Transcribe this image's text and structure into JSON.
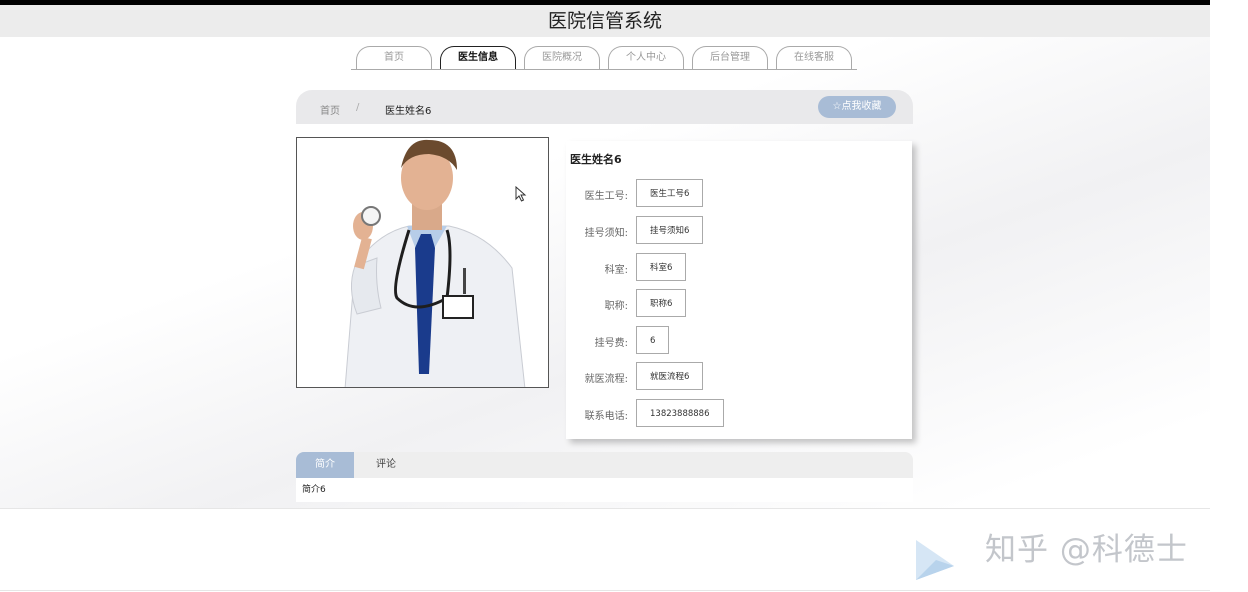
{
  "app": {
    "title": "医院信管系统"
  },
  "nav": {
    "tabs": [
      {
        "label": "首页",
        "active": false
      },
      {
        "label": "医生信息",
        "active": true
      },
      {
        "label": "医院概况",
        "active": false
      },
      {
        "label": "个人中心",
        "active": false
      },
      {
        "label": "后台管理",
        "active": false
      },
      {
        "label": "在线客服",
        "active": false
      }
    ]
  },
  "breadcrumb": {
    "home": "首页",
    "separator": "/",
    "current": "医生姓名6"
  },
  "favorite": {
    "label": "☆点我收藏"
  },
  "doctor": {
    "name": "医生姓名6",
    "fields": [
      {
        "label": "医生工号:",
        "value": "医生工号6"
      },
      {
        "label": "挂号须知:",
        "value": "挂号须知6"
      },
      {
        "label": "科室:",
        "value": "科室6"
      },
      {
        "label": "职称:",
        "value": "职称6"
      },
      {
        "label": "挂号费:",
        "value": "6"
      },
      {
        "label": "就医流程:",
        "value": "就医流程6"
      },
      {
        "label": "联系电话:",
        "value": "13823888886"
      }
    ]
  },
  "detail_tabs": {
    "intro": "简介",
    "review": "评论",
    "intro_content": "简介6"
  },
  "watermark": {
    "text": "知乎 @科德士"
  },
  "colors": {
    "accent": "#a8bcd6",
    "header_bg": "#ececec"
  }
}
